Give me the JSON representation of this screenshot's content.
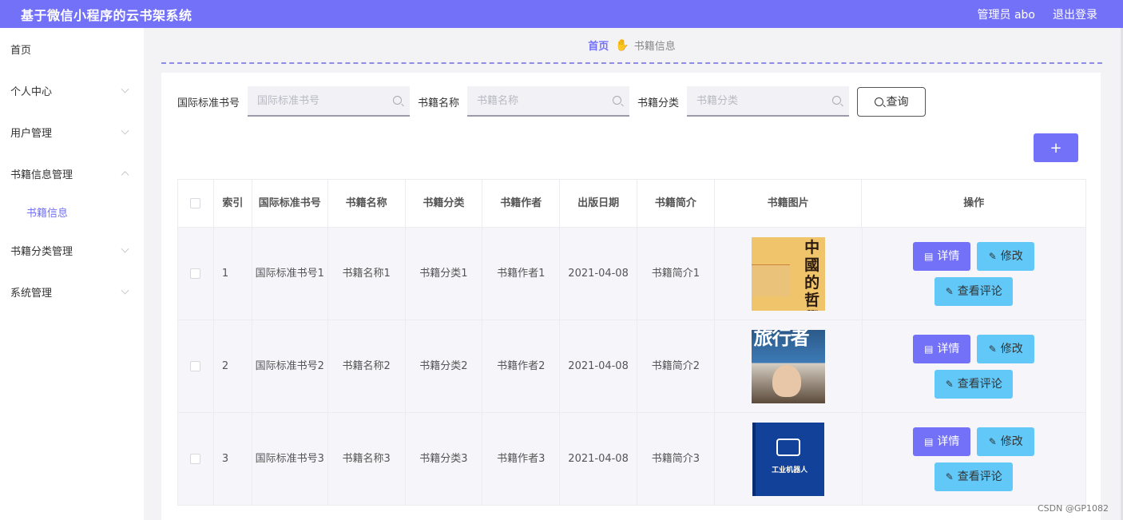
{
  "app": {
    "title": "基于微信小程序的云书架系统",
    "user_label": "管理员 abo",
    "logout_label": "退出登录"
  },
  "sidebar": {
    "items": [
      {
        "label": "首页"
      },
      {
        "label": "个人中心"
      },
      {
        "label": "用户管理"
      },
      {
        "label": "书籍信息管理"
      },
      {
        "label": "书籍信息"
      },
      {
        "label": "书籍分类管理"
      },
      {
        "label": "系统管理"
      }
    ]
  },
  "breadcrumb": {
    "home": "首页",
    "current": "书籍信息"
  },
  "search": {
    "fields": [
      {
        "label": "国际标准书号",
        "placeholder": "国际标准书号",
        "value": ""
      },
      {
        "label": "书籍名称",
        "placeholder": "书籍名称",
        "value": ""
      },
      {
        "label": "书籍分类",
        "placeholder": "书籍分类",
        "value": ""
      }
    ],
    "query_label": "查询"
  },
  "toolbar": {
    "add_label": "+"
  },
  "table": {
    "headers": [
      "索引",
      "国际标准书号",
      "书籍名称",
      "书籍分类",
      "书籍作者",
      "出版日期",
      "书籍简介",
      "书籍图片",
      "操作"
    ],
    "rows": [
      {
        "index": "1",
        "isbn": "国际标准书号1",
        "name": "书籍名称1",
        "category": "书籍分类1",
        "author": "书籍作者1",
        "date": "2021-04-08",
        "intro": "书籍简介1",
        "cover_text": "中國的哲學"
      },
      {
        "index": "2",
        "isbn": "国际标准书号2",
        "name": "书籍名称2",
        "category": "书籍分类2",
        "author": "书籍作者2",
        "date": "2021-04-08",
        "intro": "书籍简介2",
        "cover_text": "旅行者"
      },
      {
        "index": "3",
        "isbn": "国际标准书号3",
        "name": "书籍名称3",
        "category": "书籍分类3",
        "author": "书籍作者3",
        "date": "2021-04-08",
        "intro": "书籍简介3",
        "cover_text": "工业机器人"
      }
    ],
    "actions": {
      "detail": "详情",
      "edit": "修改",
      "comments": "查看评论"
    }
  },
  "watermark": "CSDN @GP1082",
  "colors": {
    "accent": "#7371f8",
    "secondary": "#62c8f8"
  }
}
